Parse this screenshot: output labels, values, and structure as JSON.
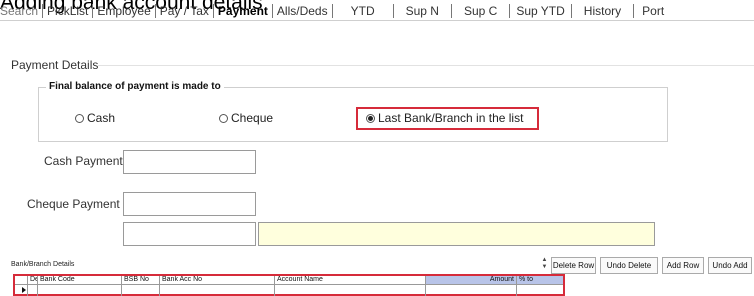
{
  "heading": "Adding bank account details",
  "tabs": [
    "Search",
    "PickList",
    "Employee",
    "Pay / Tax",
    "Payment",
    "Alls/Deds",
    "YTD",
    "Sup N",
    "Sup C",
    "Sup YTD",
    "History",
    "Port"
  ],
  "active_tab": "Payment",
  "payment_details": {
    "section_label": "Payment Details",
    "group_title": "Final balance of payment is made to",
    "options": [
      {
        "label": "Cash",
        "selected": false
      },
      {
        "label": "Cheque",
        "selected": false
      },
      {
        "label": "Last Bank/Branch in the list",
        "selected": true
      }
    ]
  },
  "fields": {
    "cash_payment_label": "Cash Payment",
    "cash_payment_value": "",
    "cheque_payment_label": "Cheque Payment",
    "cheque_payment_value": "",
    "extra_value": "",
    "extra_note": ""
  },
  "bank_branch": {
    "label": "Bank/Branch Details",
    "buttons": [
      "Delete Row",
      "Undo Delete",
      "Add Row",
      "Undo Add"
    ],
    "columns": [
      "Del",
      "Bank Code",
      "BSB No",
      "Bank Acc No",
      "Account Name",
      "Amount",
      "% to"
    ],
    "rows": [
      [
        "",
        "",
        "",
        "",
        "",
        "",
        ""
      ]
    ]
  },
  "colors": {
    "highlight": "#d62b3a",
    "amount_column": "#b8c4e8",
    "note_field": "#ffffdd"
  }
}
